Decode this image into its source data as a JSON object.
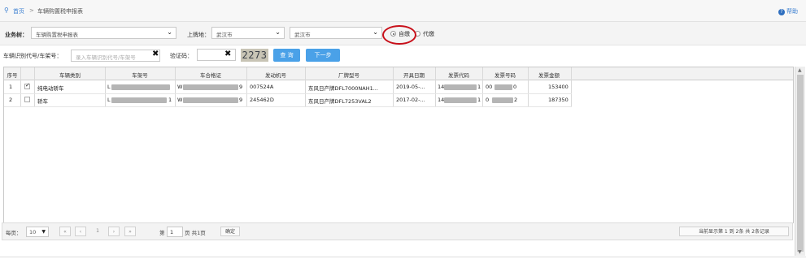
{
  "breadcrumb": {
    "home": "首页",
    "separator": ">",
    "current": "车辆购置税申报表"
  },
  "help": {
    "label": "帮助"
  },
  "filters": {
    "business_label": "业务树：",
    "business_value": "车辆购置税申报表",
    "location_label": "上牌地：",
    "location_city": "武汉市",
    "location_district": "武汉市",
    "radio_self": "自缴",
    "radio_agent": "代缴"
  },
  "search": {
    "vin_label": "车辆识别代号/车架号：",
    "vin_placeholder": "录入车辆识别代号/车架号",
    "captcha_label": "验证码：",
    "captcha_value": "",
    "captcha_image": "2273",
    "query_button": "查 询",
    "next_button": "下一步"
  },
  "table": {
    "headers": [
      "序号",
      "车辆类别",
      "车架号",
      "车合格证",
      "发动机号",
      "厂牌型号",
      "开具日期",
      "发票代码",
      "发票号码",
      "发票金额"
    ],
    "rows": [
      {
        "index": "1",
        "checked": true,
        "category": "纯电动轿车",
        "frame_prefix": "L",
        "frame_suffix": "",
        "cert_prefix": "W",
        "cert_suffix": "9",
        "engine": "007524A",
        "model": "东风日产牌DFL7000NAH1...",
        "date": "2019-05-...",
        "invoice_code_prefix": "14",
        "invoice_code_suffix": "1",
        "invoice_no_prefix": "00",
        "invoice_no_suffix": "0",
        "amount": "153400"
      },
      {
        "index": "2",
        "checked": false,
        "category": "轿车",
        "frame_prefix": "L",
        "frame_suffix": "1",
        "cert_prefix": "W",
        "cert_suffix": "9",
        "engine": "245462D",
        "model": "东风日产牌DFL7253VAL2",
        "date": "2017-02-...",
        "invoice_code_prefix": "14",
        "invoice_code_suffix": "1",
        "invoice_no_prefix": "0",
        "invoice_no_suffix": "2",
        "amount": "187350"
      }
    ]
  },
  "pager": {
    "per_page_label": "每页：",
    "per_page_value": "10",
    "first": "«",
    "prev": "‹",
    "current_page": "1",
    "next": "›",
    "last": "»",
    "page_prefix": "第",
    "page_input": "1",
    "page_suffix": "页 共1页",
    "go_button": "确定",
    "summary": "当前显示第 1 到 2条 共 2条记录"
  }
}
